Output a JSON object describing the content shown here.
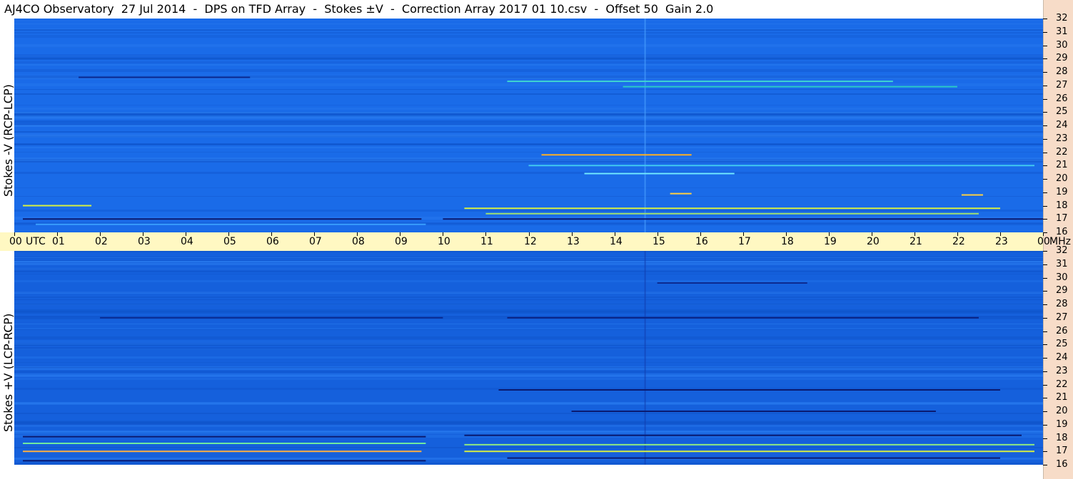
{
  "title": "AJ4CO Observatory  27 Jul 2014  -  DPS on TFD Array  -  Stokes ±V  -  Correction Array 2017 01 10.csv  -  Offset 50  Gain 2.0",
  "chart_data": [
    {
      "type": "heatmap",
      "panel": "top",
      "ylabel": "Stokes -V (RCP-LCP)",
      "x_unit": "UTC",
      "y_unit": "MHz",
      "xlim": [
        0,
        24
      ],
      "ylim": [
        16,
        32
      ],
      "x_ticks": [
        "00",
        "01",
        "02",
        "03",
        "04",
        "05",
        "06",
        "07",
        "08",
        "09",
        "10",
        "11",
        "12",
        "13",
        "14",
        "15",
        "16",
        "17",
        "18",
        "19",
        "20",
        "21",
        "22",
        "23",
        "00"
      ],
      "y_ticks": [
        "16",
        "17",
        "18",
        "19",
        "20",
        "21",
        "22",
        "23",
        "24",
        "25",
        "26",
        "27",
        "28",
        "29",
        "30",
        "31",
        "32"
      ],
      "background_color": "#1a6be8",
      "features": [
        {
          "start": 12.3,
          "end": 15.8,
          "freq": 21.8,
          "color": "#ffb020"
        },
        {
          "start": 10.5,
          "end": 23.0,
          "freq": 17.8,
          "color": "#d8f040"
        },
        {
          "start": 11.0,
          "end": 22.5,
          "freq": 17.4,
          "color": "#a0e070"
        },
        {
          "start": 0.2,
          "end": 9.5,
          "freq": 17.0,
          "color": "#0a1a70"
        },
        {
          "start": 10.0,
          "end": 24.0,
          "freq": 17.0,
          "color": "#0a1a70"
        },
        {
          "start": 0.2,
          "end": 1.8,
          "freq": 18.0,
          "color": "#d8f040"
        },
        {
          "start": 0.5,
          "end": 9.6,
          "freq": 16.6,
          "color": "#3aa0ff"
        },
        {
          "start": 13.3,
          "end": 16.8,
          "freq": 20.4,
          "color": "#70e8ff"
        },
        {
          "start": 12.0,
          "end": 23.8,
          "freq": 21.0,
          "color": "#40c8f0"
        },
        {
          "start": 11.5,
          "end": 20.5,
          "freq": 27.3,
          "color": "#40d8d0"
        },
        {
          "start": 1.5,
          "end": 5.5,
          "freq": 27.6,
          "color": "#0c2a90"
        },
        {
          "start": 14.2,
          "end": 22.0,
          "freq": 26.9,
          "color": "#2bc8c8"
        },
        {
          "start": 15.3,
          "end": 15.8,
          "freq": 18.9,
          "color": "#ffd040"
        },
        {
          "start": 22.1,
          "end": 22.6,
          "freq": 18.8,
          "color": "#ffd040"
        }
      ]
    },
    {
      "type": "heatmap",
      "panel": "bottom",
      "ylabel": "Stokes +V (LCP-RCP)",
      "x_unit": "UTC",
      "y_unit": "MHz",
      "xlim": [
        0,
        24
      ],
      "ylim": [
        16,
        32
      ],
      "x_ticks": [
        "00",
        "01",
        "02",
        "03",
        "04",
        "05",
        "06",
        "07",
        "08",
        "09",
        "10",
        "11",
        "12",
        "13",
        "14",
        "15",
        "16",
        "17",
        "18",
        "19",
        "20",
        "21",
        "22",
        "23",
        "00"
      ],
      "y_ticks": [
        "16",
        "17",
        "18",
        "19",
        "20",
        "21",
        "22",
        "23",
        "24",
        "25",
        "26",
        "27",
        "28",
        "29",
        "30",
        "31",
        "32"
      ],
      "background_color": "#1560dc",
      "features": [
        {
          "start": 0.2,
          "end": 9.6,
          "freq": 18.1,
          "color": "#0a1a70"
        },
        {
          "start": 10.5,
          "end": 23.5,
          "freq": 18.2,
          "color": "#0a1a70"
        },
        {
          "start": 0.2,
          "end": 9.6,
          "freq": 17.6,
          "color": "#70e8a0"
        },
        {
          "start": 10.5,
          "end": 23.8,
          "freq": 17.5,
          "color": "#90e880"
        },
        {
          "start": 0.2,
          "end": 9.5,
          "freq": 17.0,
          "color": "#ffb040"
        },
        {
          "start": 10.5,
          "end": 23.8,
          "freq": 17.0,
          "color": "#d8f040"
        },
        {
          "start": 0.2,
          "end": 9.6,
          "freq": 16.3,
          "color": "#0a1a70"
        },
        {
          "start": 11.5,
          "end": 23.0,
          "freq": 16.5,
          "color": "#0a1a70"
        },
        {
          "start": 11.3,
          "end": 23.0,
          "freq": 21.6,
          "color": "#0a1a70"
        },
        {
          "start": 13.0,
          "end": 21.5,
          "freq": 20.0,
          "color": "#0a1a70"
        },
        {
          "start": 2.0,
          "end": 10.0,
          "freq": 27.0,
          "color": "#0a2a90"
        },
        {
          "start": 11.5,
          "end": 22.5,
          "freq": 27.0,
          "color": "#0a2080"
        },
        {
          "start": 15.0,
          "end": 18.5,
          "freq": 29.6,
          "color": "#0c2a90"
        }
      ]
    }
  ]
}
